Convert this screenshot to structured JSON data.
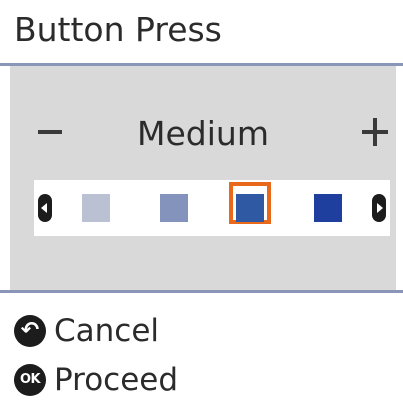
{
  "header": {
    "title": "Button Press"
  },
  "level_selector": {
    "minus_icon": "minus-icon",
    "plus_icon": "plus-icon",
    "current_label": "Medium",
    "selected_index": 2,
    "swatches": [
      {
        "color": "#b9c1d2"
      },
      {
        "color": "#8393bb"
      },
      {
        "color": "#2f5aa3"
      },
      {
        "color": "#1f3f9e"
      }
    ],
    "selection_color": "#e8691a"
  },
  "actions": {
    "cancel": {
      "icon": "back-icon",
      "label": "Cancel"
    },
    "proceed": {
      "icon": "ok-icon",
      "icon_text": "OK",
      "label": "Proceed"
    }
  },
  "colors": {
    "panel_background": "#d9d9d9",
    "divider": "#8a96b8"
  }
}
